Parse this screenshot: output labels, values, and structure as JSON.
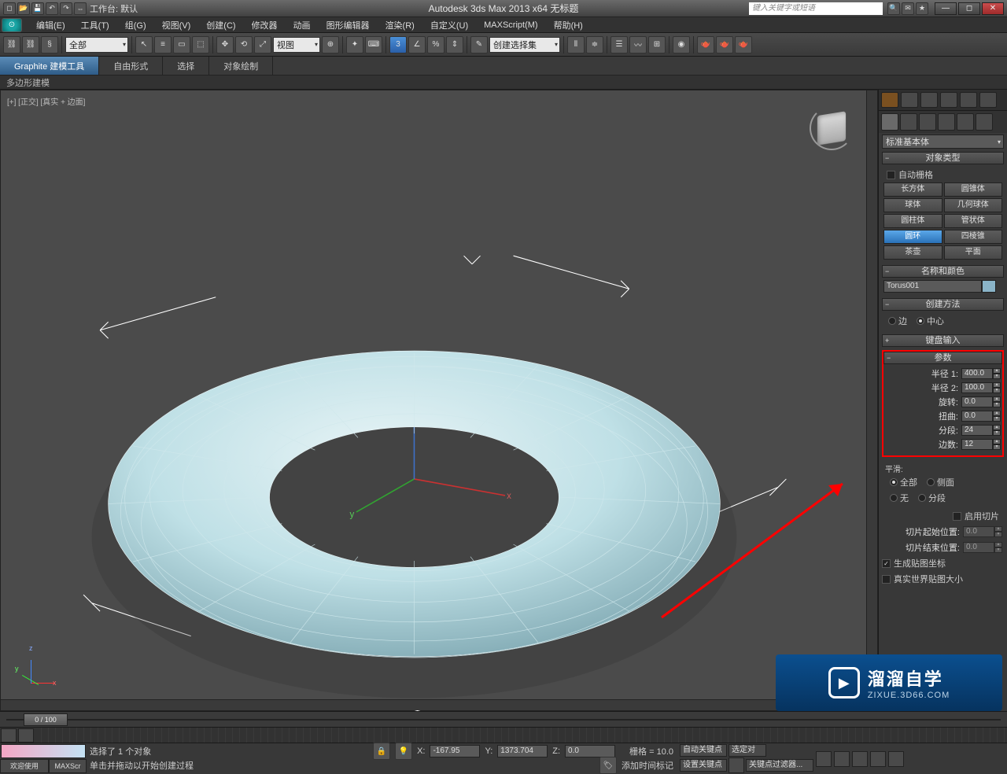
{
  "titlebar": {
    "workspace_label": "工作台: 默认",
    "app_title": "Autodesk 3ds Max  2013 x64     无标题",
    "search_placeholder": "键入关键字或短语",
    "qat_icons": [
      "new-file-icon",
      "open-icon",
      "save-icon",
      "undo-icon",
      "redo-icon",
      "workspace-icon"
    ]
  },
  "menubar": [
    "编辑(E)",
    "工具(T)",
    "组(G)",
    "视图(V)",
    "创建(C)",
    "修改器",
    "动画",
    "图形编辑器",
    "渲染(R)",
    "自定义(U)",
    "MAXScript(M)",
    "帮助(H)"
  ],
  "toolbar": {
    "filter_all": "全部",
    "view_dropdown": "视图",
    "named_sel": "创建选择集"
  },
  "ribbon": {
    "tabs": [
      "Graphite 建模工具",
      "自由形式",
      "选择",
      "对象绘制"
    ],
    "sub": "多边形建模"
  },
  "viewport": {
    "label": "[+] [正交] [真实 + 边面]",
    "axis": {
      "x": "x",
      "y": "y",
      "z": "z"
    }
  },
  "cmdpanel": {
    "category": "标准基本体",
    "object_type": {
      "title": "对象类型",
      "autogrid": "自动栅格"
    },
    "primitives": [
      [
        "长方体",
        "圆锥体"
      ],
      [
        "球体",
        "几何球体"
      ],
      [
        "圆柱体",
        "管状体"
      ],
      [
        "圆环",
        "四棱锥"
      ],
      [
        "茶壶",
        "平面"
      ]
    ],
    "active_primitive": "圆环",
    "name_color": {
      "title": "名称和颜色",
      "name": "Torus001"
    },
    "creation": {
      "title": "创建方法",
      "opt_edge": "边",
      "opt_center": "中心"
    },
    "keyboard": {
      "title": "键盘输入"
    },
    "params": {
      "title": "参数",
      "radius1": {
        "lbl": "半径 1:",
        "val": "400.0"
      },
      "radius2": {
        "lbl": "半径 2:",
        "val": "100.0"
      },
      "rotation": {
        "lbl": "旋转:",
        "val": "0.0"
      },
      "twist": {
        "lbl": "扭曲:",
        "val": "0.0"
      },
      "segments": {
        "lbl": "分段:",
        "val": "24"
      },
      "sides": {
        "lbl": "边数:",
        "val": "12"
      }
    },
    "smooth": {
      "title": "平滑:",
      "all": "全部",
      "side": "侧面",
      "none": "无",
      "seg": "分段"
    },
    "slice": {
      "enable": "启用切片",
      "start": "切片起始位置:",
      "start_v": "0.0",
      "end": "切片结束位置:",
      "end_v": "0.0"
    },
    "mapping": {
      "gen": "生成贴图坐标",
      "real": "真实世界贴图大小"
    }
  },
  "timeslider": {
    "pos": "0 / 100"
  },
  "status": {
    "welcome": "欢迎使用",
    "script": "MAXScr",
    "sel": "选择了 1 个对象",
    "hint": "单击并拖动以开始创建过程",
    "x_lbl": "X:",
    "x": "-167.95",
    "y_lbl": "Y:",
    "y": "1373.704",
    "z_lbl": "Z:",
    "z": "0.0",
    "grid": "栅格 = 10.0",
    "add_time": "添加时间标记",
    "autokey": "自动关键点",
    "setkey": "设置关键点",
    "sel_label": "选定对",
    "keyfilter": "关键点过滤器..."
  },
  "watermark": {
    "big": "溜溜自学",
    "small": "ZIXUE.3D66.COM"
  }
}
